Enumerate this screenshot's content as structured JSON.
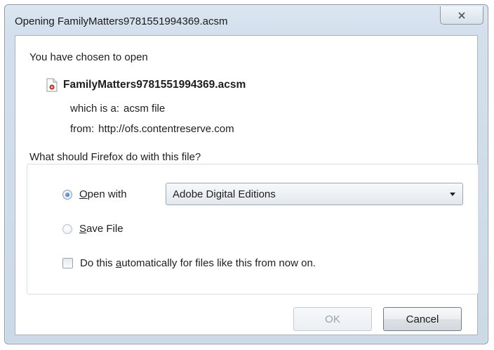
{
  "window": {
    "title": "Opening FamilyMatters9781551994369.acsm"
  },
  "dialog": {
    "intro": "You have chosen to open",
    "file_name": "FamilyMatters9781551994369.acsm",
    "type_label": "which is a:",
    "type_value": "acsm file",
    "from_label": "from:",
    "from_value": "http://ofs.contentreserve.com",
    "question": "What should Firefox do with this file?",
    "options": {
      "open_with": {
        "mnemonic": "O",
        "rest": "pen with",
        "checked": true
      },
      "save_file": {
        "mnemonic": "S",
        "rest": "ave File",
        "checked": false
      }
    },
    "app_select": {
      "selected": "Adobe Digital Editions"
    },
    "auto_checkbox": {
      "pre": "Do this ",
      "mnemonic": "a",
      "post": "utomatically for files like this from now on.",
      "checked": false
    }
  },
  "buttons": {
    "ok": "OK",
    "cancel": "Cancel"
  },
  "icons": {
    "close": "close-icon",
    "file": "acsm-file-icon",
    "dropdown": "chevron-down-icon"
  },
  "colors": {
    "frame": "#d3dfec",
    "radio_selected": "#1f5fae"
  }
}
